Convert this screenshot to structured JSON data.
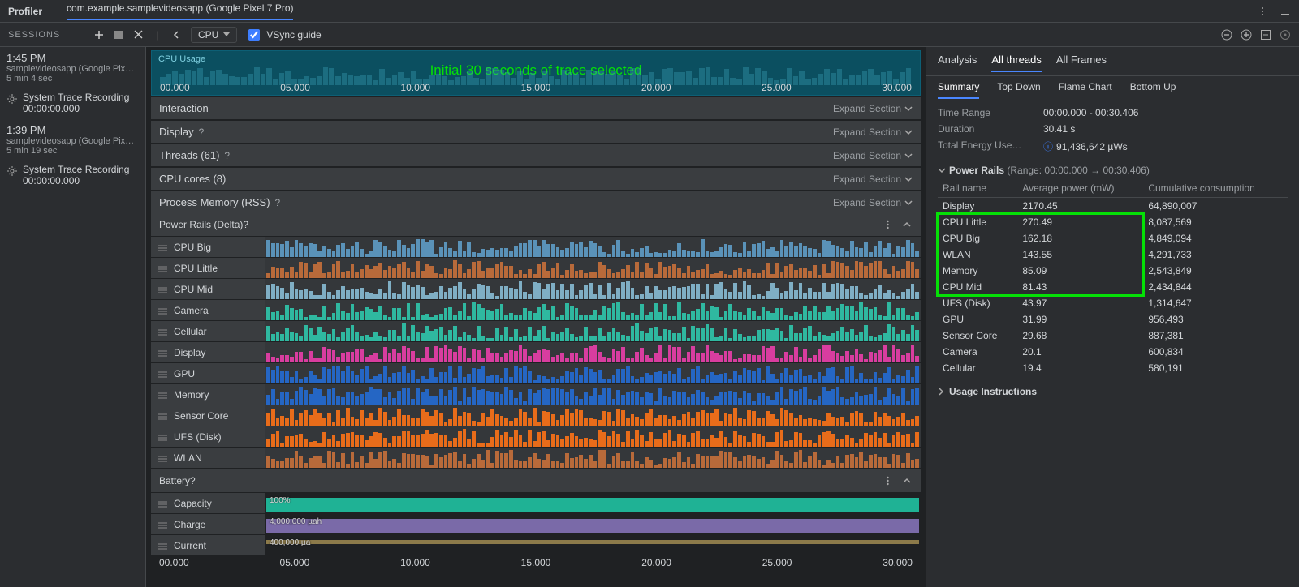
{
  "title": "Profiler",
  "tab": "com.example.samplevideosapp (Google Pixel 7 Pro)",
  "toolbar": {
    "sessions_label": "SESSIONS",
    "dropdown": "CPU",
    "vsync": "VSync guide"
  },
  "sessions": [
    {
      "time": "1:45 PM",
      "name": "samplevideosapp (Google Pixel …",
      "dur": "5 min 4 sec",
      "rec": "System Trace Recording",
      "recdur": "00:00:00.000"
    },
    {
      "time": "1:39 PM",
      "name": "samplevideosapp (Google Pixel …",
      "dur": "5 min 19 sec",
      "rec": "System Trace Recording",
      "recdur": "00:00:00.000"
    }
  ],
  "cpu_strip": {
    "label": "CPU Usage",
    "anno": "Initial 30 seconds of trace selected",
    "ticks": [
      "00.000",
      "05.000",
      "10.000",
      "15.000",
      "20.000",
      "25.000",
      "30.000"
    ]
  },
  "sections": [
    {
      "title": "Interaction",
      "q": false,
      "exp": "Expand Section"
    },
    {
      "title": "Display",
      "q": true,
      "exp": "Expand Section"
    },
    {
      "title": "Threads (61)",
      "q": true,
      "exp": "Expand Section"
    },
    {
      "title": "CPU cores (8)",
      "q": false,
      "exp": "Expand Section"
    },
    {
      "title": "Process Memory (RSS)",
      "q": true,
      "exp": "Expand Section"
    }
  ],
  "power_rails": {
    "title": "Power Rails (Delta)",
    "q": true,
    "legend": [
      "CPU Big",
      "CPU Little",
      "CPU Mid",
      "Camera",
      "Cellular",
      "Display",
      "GPU",
      "Memory",
      "Sensor Core",
      "UFS (Disk)",
      "WLAN"
    ],
    "colors": [
      "#5a92b8",
      "#b86a3a",
      "#7faec4",
      "#2fb8a0",
      "#2fb8a0",
      "#d83d9f",
      "#2566c4",
      "#2566c4",
      "#e86c1a",
      "#e86c1a",
      "#b86a3a"
    ]
  },
  "battery": {
    "title": "Battery",
    "q": true,
    "legend": [
      "Capacity",
      "Charge",
      "Current"
    ],
    "rows": [
      {
        "label": "100%",
        "color": "#1fb295"
      },
      {
        "label": "4,000,000 µah",
        "color": "#7a6aa8"
      },
      {
        "label": "400,000 µa",
        "color": "#8c7a4a"
      }
    ]
  },
  "bottom_ticks": [
    "00.000",
    "05.000",
    "10.000",
    "15.000",
    "20.000",
    "25.000",
    "30.000"
  ],
  "inspector": {
    "tabs": [
      "Analysis",
      "All threads",
      "All Frames"
    ],
    "active_tab": 1,
    "subtabs": [
      "Summary",
      "Top Down",
      "Flame Chart",
      "Bottom Up"
    ],
    "active_sub": 0,
    "kv": [
      {
        "k": "Time Range",
        "v": "00:00.000 - 00:30.406"
      },
      {
        "k": "Duration",
        "v": "30.41 s"
      },
      {
        "k": "Total Energy Use…",
        "v": "91,436,642 µWs",
        "info": true
      }
    ],
    "pr_title": "Power Rails",
    "pr_range": "(Range: 00:00.000 → 00:30.406)",
    "pr_headers": [
      "Rail name",
      "Average power (mW)",
      "Cumulative consumption"
    ],
    "pr_rows": [
      {
        "n": "Display",
        "p": "2170.45",
        "c": "64,890,007"
      },
      {
        "n": "CPU Little",
        "p": "270.49",
        "c": "8,087,569"
      },
      {
        "n": "CPU Big",
        "p": "162.18",
        "c": "4,849,094"
      },
      {
        "n": "WLAN",
        "p": "143.55",
        "c": "4,291,733"
      },
      {
        "n": "Memory",
        "p": "85.09",
        "c": "2,543,849"
      },
      {
        "n": "CPU Mid",
        "p": "81.43",
        "c": "2,434,844"
      },
      {
        "n": "UFS (Disk)",
        "p": "43.97",
        "c": "1,314,647"
      },
      {
        "n": "GPU",
        "p": "31.99",
        "c": "956,493"
      },
      {
        "n": "Sensor Core",
        "p": "29.68",
        "c": "887,381"
      },
      {
        "n": "Camera",
        "p": "20.1",
        "c": "600,834"
      },
      {
        "n": "Cellular",
        "p": "19.4",
        "c": "580,191"
      }
    ],
    "usage": "Usage Instructions"
  },
  "chart_data": {
    "type": "table",
    "title": "Power Rails (Range: 00:00.000 → 00:30.406)",
    "columns": [
      "Rail name",
      "Average power (mW)",
      "Cumulative consumption (µWs)"
    ],
    "rows": [
      [
        "Display",
        2170.45,
        64890007
      ],
      [
        "CPU Little",
        270.49,
        8087569
      ],
      [
        "CPU Big",
        162.18,
        4849094
      ],
      [
        "WLAN",
        143.55,
        4291733
      ],
      [
        "Memory",
        85.09,
        2543849
      ],
      [
        "CPU Mid",
        81.43,
        2434844
      ],
      [
        "UFS (Disk)",
        43.97,
        1314647
      ],
      [
        "GPU",
        31.99,
        956493
      ],
      [
        "Sensor Core",
        29.68,
        887381
      ],
      [
        "Camera",
        20.1,
        600834
      ],
      [
        "Cellular",
        19.4,
        580191
      ]
    ]
  }
}
